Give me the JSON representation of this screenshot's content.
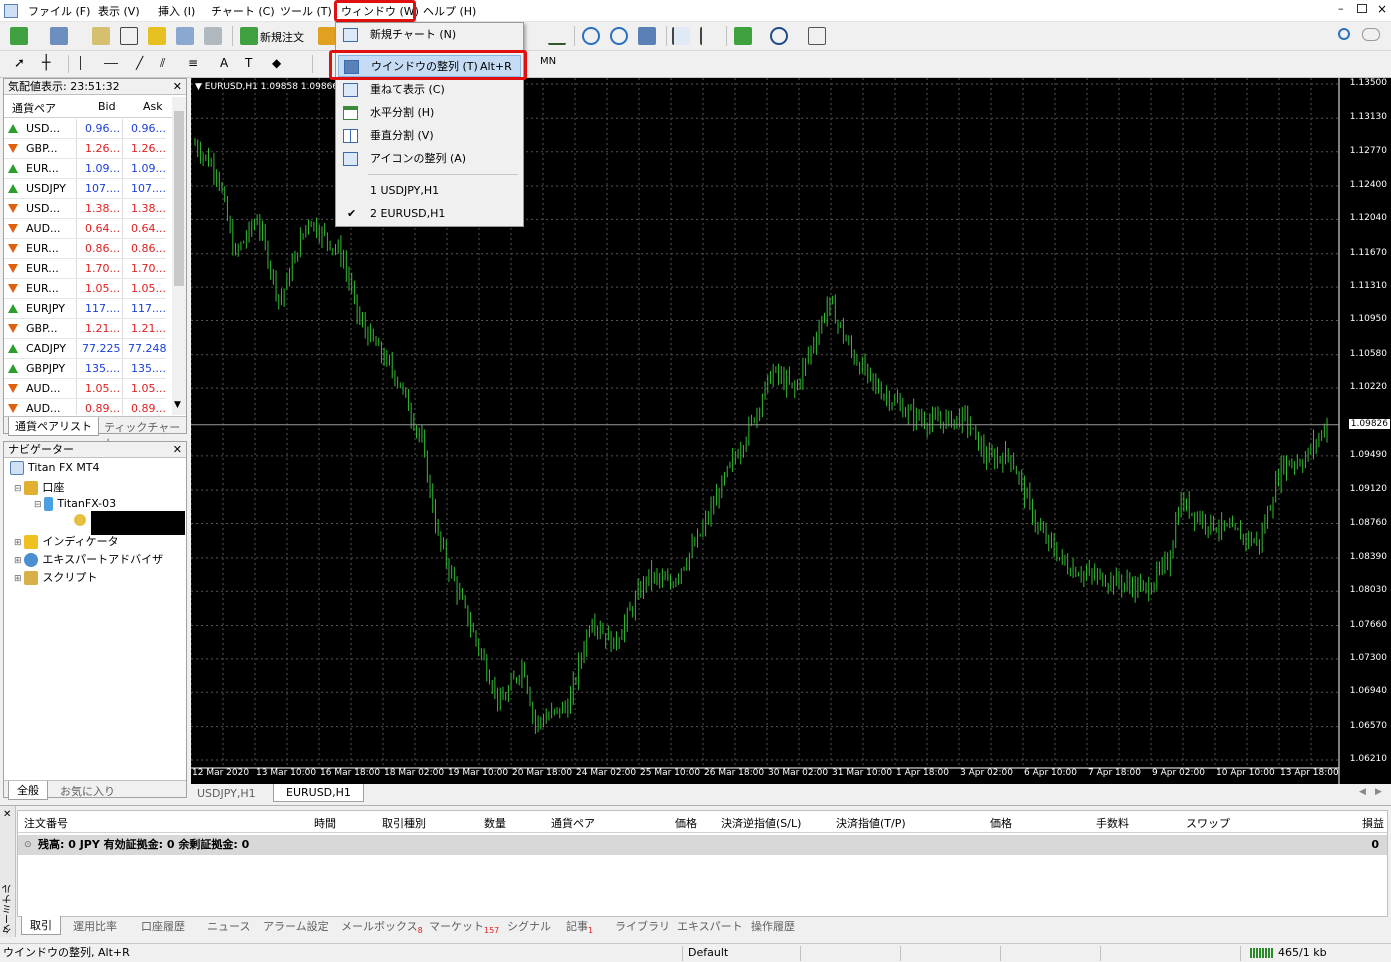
{
  "menu": {
    "items": [
      "ファイル (F)",
      "表示 (V)",
      "挿入 (I)",
      "チャート (C)",
      "ツール (T)",
      "ウィンドウ (W)",
      "ヘルプ (H)"
    ]
  },
  "toolbar": {
    "new_order": "新規注文"
  },
  "dropdown": {
    "new_chart": "新規チャート (N)",
    "tile": "ウインドウの整列 (T)",
    "tile_shortcut": "Alt+R",
    "cascade": "重ねて表示 (C)",
    "tile_horiz": "水平分割 (H)",
    "tile_vert": "垂直分割 (V)",
    "arrange_icons": "アイコンの整列 (A)",
    "win1": "1 USDJPY,H1",
    "win2": "2 EURUSD,H1"
  },
  "market_watch": {
    "title": "気配値表示: 23:51:32",
    "col_pair": "通貨ペア",
    "col_bid": "Bid",
    "col_ask": "Ask",
    "rows": [
      {
        "sym": "USD...",
        "bid": "0.96...",
        "ask": "0.96...",
        "dir": "up"
      },
      {
        "sym": "GBP...",
        "bid": "1.26...",
        "ask": "1.26...",
        "dir": "down"
      },
      {
        "sym": "EUR...",
        "bid": "1.09...",
        "ask": "1.09...",
        "dir": "up"
      },
      {
        "sym": "USDJPY",
        "bid": "107....",
        "ask": "107....",
        "dir": "up"
      },
      {
        "sym": "USD...",
        "bid": "1.38...",
        "ask": "1.38...",
        "dir": "down"
      },
      {
        "sym": "AUD...",
        "bid": "0.64...",
        "ask": "0.64...",
        "dir": "down"
      },
      {
        "sym": "EUR...",
        "bid": "0.86...",
        "ask": "0.86...",
        "dir": "down"
      },
      {
        "sym": "EUR...",
        "bid": "1.70...",
        "ask": "1.70...",
        "dir": "down"
      },
      {
        "sym": "EUR...",
        "bid": "1.05...",
        "ask": "1.05...",
        "dir": "down"
      },
      {
        "sym": "EURJPY",
        "bid": "117....",
        "ask": "117....",
        "dir": "up"
      },
      {
        "sym": "GBP...",
        "bid": "1.21...",
        "ask": "1.21...",
        "dir": "down"
      },
      {
        "sym": "CADJPY",
        "bid": "77.225",
        "ask": "77.248",
        "dir": "up"
      },
      {
        "sym": "GBPJPY",
        "bid": "135....",
        "ask": "135....",
        "dir": "up"
      },
      {
        "sym": "AUD...",
        "bid": "1.05...",
        "ask": "1.05...",
        "dir": "down"
      },
      {
        "sym": "AUD...",
        "bid": "0.89...",
        "ask": "0.89...",
        "dir": "down"
      }
    ],
    "tab_symbols": "通貨ペアリスト",
    "tab_tick": "ティックチャート"
  },
  "navigator": {
    "title": "ナビゲーター",
    "root": "Titan FX MT4",
    "accounts": "口座",
    "server": "TitanFX-03",
    "indicators": "インディケータ",
    "experts": "エキスパートアドバイザ",
    "scripts": "スクリプト",
    "tab_all": "全般",
    "tab_fav": "お気に入り"
  },
  "chart": {
    "header": "EURUSD,H1  1.09858 1.09866",
    "current_price": "1.09826",
    "y_labels": [
      "1.13500",
      "1.13130",
      "1.12770",
      "1.12400",
      "1.12040",
      "1.11670",
      "1.11310",
      "1.10950",
      "1.10580",
      "1.10220",
      "1.09490",
      "1.09120",
      "1.08760",
      "1.08390",
      "1.08030",
      "1.07660",
      "1.07300",
      "1.06940",
      "1.06570",
      "1.06210"
    ],
    "x_labels": [
      "12 Mar 2020",
      "13 Mar 10:00",
      "16 Mar 18:00",
      "18 Mar 02:00",
      "19 Mar 10:00",
      "20 Mar 18:00",
      "24 Mar 02:00",
      "25 Mar 10:00",
      "26 Mar 18:00",
      "30 Mar 02:00",
      "31 Mar 10:00",
      "1 Apr 18:00",
      "3 Apr 02:00",
      "6 Apr 10:00",
      "7 Apr 18:00",
      "9 Apr 02:00",
      "10 Apr 10:00",
      "13 Apr 18:00"
    ],
    "tab1": "USDJPY,H1",
    "tab2": "EURUSD,H1",
    "colors": {
      "bg": "#000000",
      "candles": "#33bb33",
      "grid": "#555555"
    }
  },
  "terminal": {
    "side_label": "ターミナル",
    "cols": [
      "注文番号",
      "時間",
      "取引種別",
      "数量",
      "通貨ペア",
      "価格",
      "決済逆指値(S/L)",
      "決済指値(T/P)",
      "価格",
      "手数料",
      "スワップ",
      "損益"
    ],
    "balance": "残高: 0 JPY  有効証拠金: 0  余剰証拠金: 0",
    "profit": "0",
    "tabs": [
      "取引",
      "運用比率",
      "口座履歴",
      "ニュース",
      "アラーム設定",
      "メールボックス",
      "マーケット",
      "シグナル",
      "記事",
      "ライブラリ",
      "エキスパート",
      "操作履歴"
    ],
    "mail_badge": "8",
    "market_badge": "157",
    "article_badge": "1"
  },
  "status": {
    "hint": "ウインドウの整列, Alt+R",
    "profile": "Default",
    "traffic": "465/1 kb"
  }
}
